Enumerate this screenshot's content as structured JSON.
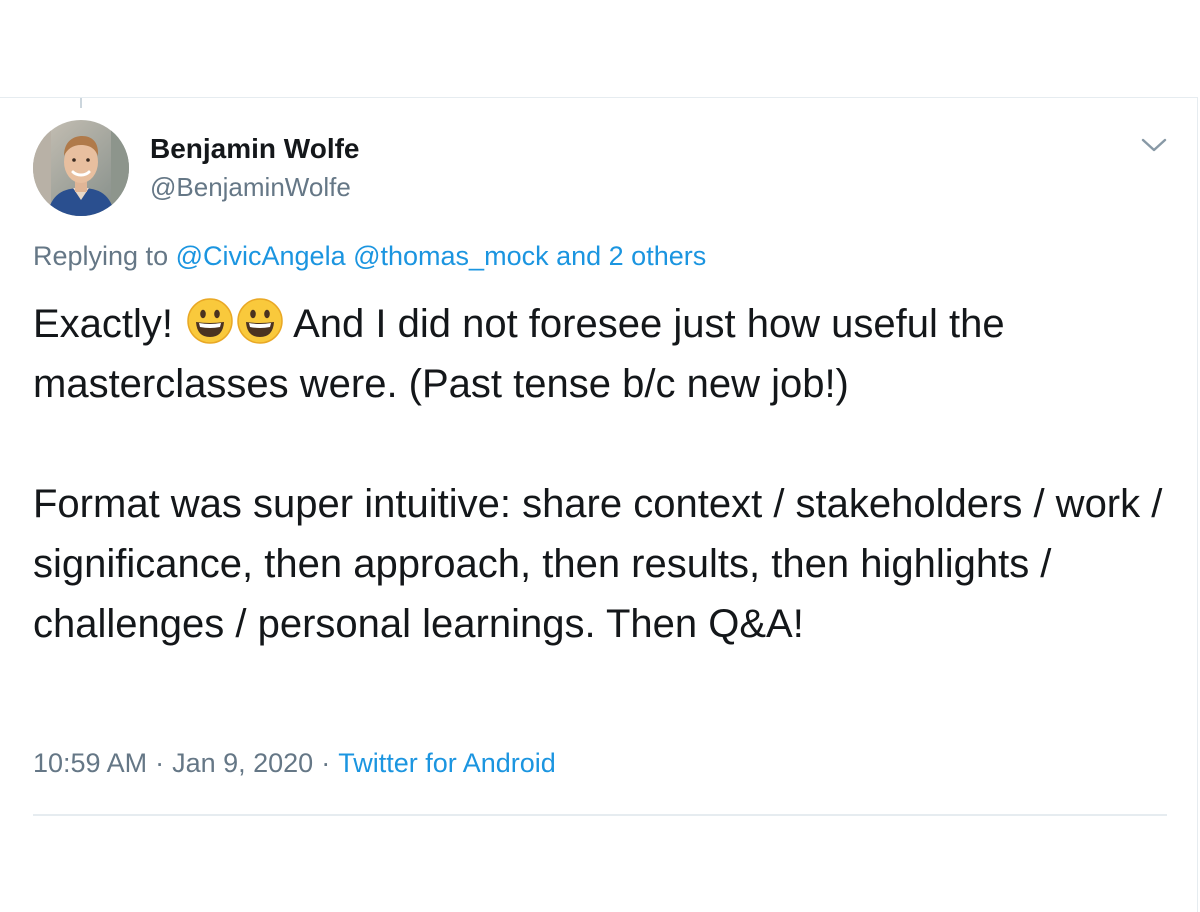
{
  "user": {
    "display_name": "Benjamin Wolfe",
    "handle": "@BenjaminWolfe"
  },
  "reply": {
    "prefix": "Replying to",
    "mentions": [
      "@CivicAngela",
      "@thomas_mock",
      "and 2 others"
    ]
  },
  "tweet": {
    "p1_before_emoji": "Exactly!",
    "emoji_name": "grinning-face-emoji",
    "p1_after_emoji": "And I did not foresee just how useful the masterclasses were. (Past tense b/c new job!)",
    "p2": "Format was super intuitive: share context / stakeholders / work / significance, then approach, then results, then highlights / challenges / personal learnings. Then Q&A!"
  },
  "meta": {
    "time": "10:59 AM",
    "date": "Jan 9, 2020",
    "source": "Twitter for Android",
    "separator": "·"
  },
  "icons": {
    "caret": "chevron-down-icon",
    "avatar": "avatar"
  },
  "colors": {
    "link": "#1b95e0",
    "secondary_text": "#657786",
    "primary_text": "#14171a",
    "border": "#e6ecf0"
  }
}
